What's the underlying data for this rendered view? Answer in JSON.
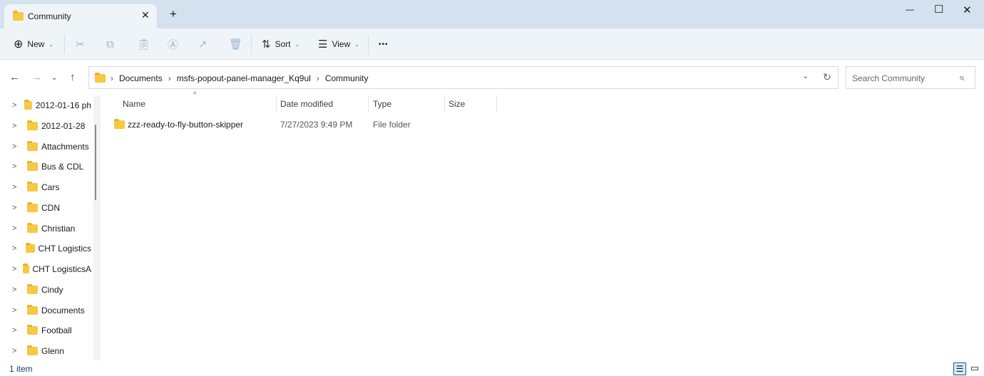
{
  "window": {
    "tab_title": "Community",
    "new_tab": "+",
    "minimize": "—",
    "maximize": "☐",
    "close": "✕"
  },
  "toolbar": {
    "new_label": "New",
    "sort_label": "Sort",
    "view_label": "View",
    "more": "•••"
  },
  "address": {
    "segments": [
      "Documents",
      "msfs-popout-panel-manager_Kq9ul",
      "Community"
    ],
    "search_placeholder": "Search Community"
  },
  "sidebar": {
    "items": [
      "2012-01-16 ph",
      "2012-01-28",
      "Attachments",
      "Bus & CDL",
      "Cars",
      "CDN",
      "Christian",
      "CHT Logistics",
      "CHT LogisticsA",
      "Cindy",
      "Documents",
      "Football",
      "Glenn"
    ]
  },
  "columns": {
    "name": "Name",
    "date": "Date modified",
    "type": "Type",
    "size": "Size"
  },
  "files": [
    {
      "name": "zzz-ready-to-fly-button-skipper",
      "date": "7/27/2023 9:49 PM",
      "type": "File folder",
      "size": ""
    }
  ],
  "status": {
    "count": "1 item"
  },
  "colors": {
    "accent": "#0067c0",
    "folder": "#f7c844",
    "titlebar": "#d4e1ee"
  }
}
